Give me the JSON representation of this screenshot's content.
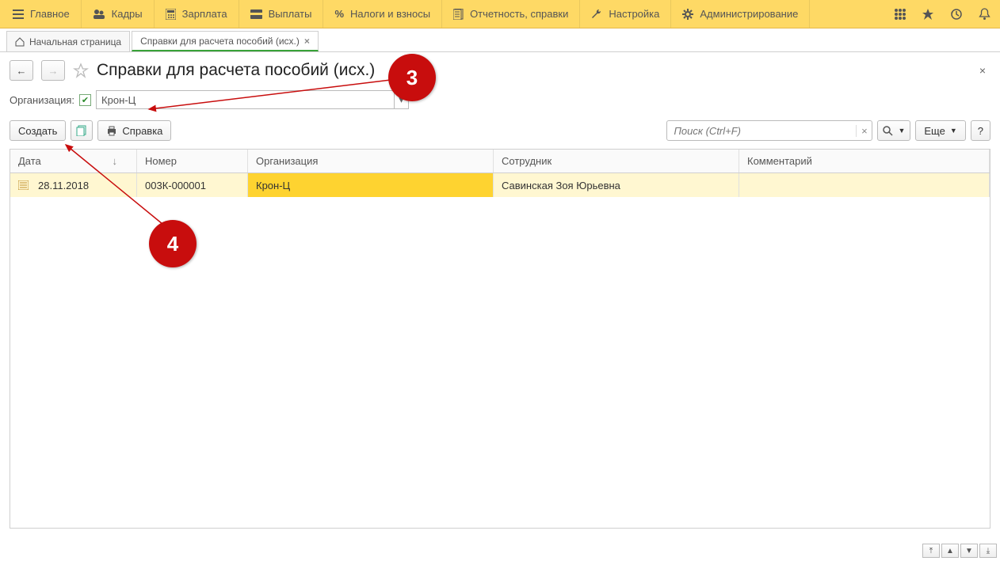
{
  "menu": {
    "items": [
      {
        "icon": "burger",
        "label": "Главное"
      },
      {
        "icon": "people",
        "label": "Кадры"
      },
      {
        "icon": "calc",
        "label": "Зарплата"
      },
      {
        "icon": "wallet",
        "label": "Выплаты"
      },
      {
        "icon": "percent",
        "label": "Налоги и взносы"
      },
      {
        "icon": "doc",
        "label": "Отчетность, справки"
      },
      {
        "icon": "wrench",
        "label": "Настройка"
      },
      {
        "icon": "gear",
        "label": "Администрирование"
      }
    ]
  },
  "tabs": {
    "home": "Начальная страница",
    "active": "Справки для расчета пособий (исх.)"
  },
  "header": {
    "title": "Справки для расчета пособий (исх.)"
  },
  "filter": {
    "label": "Организация:",
    "checked": true,
    "value": "Крон-Ц"
  },
  "toolbar": {
    "create": "Создать",
    "print": "Справка",
    "more": "Еще",
    "help": "?",
    "search_placeholder": "Поиск (Ctrl+F)"
  },
  "grid": {
    "columns": {
      "date": "Дата",
      "number": "Номер",
      "org": "Организация",
      "employee": "Сотрудник",
      "comment": "Комментарий"
    },
    "rows": [
      {
        "date": "28.11.2018",
        "number": "003К-000001",
        "org": "Крон-Ц",
        "employee": "Савинская Зоя Юрьевна",
        "comment": ""
      }
    ]
  },
  "annotations": {
    "a3": "3",
    "a4": "4"
  }
}
